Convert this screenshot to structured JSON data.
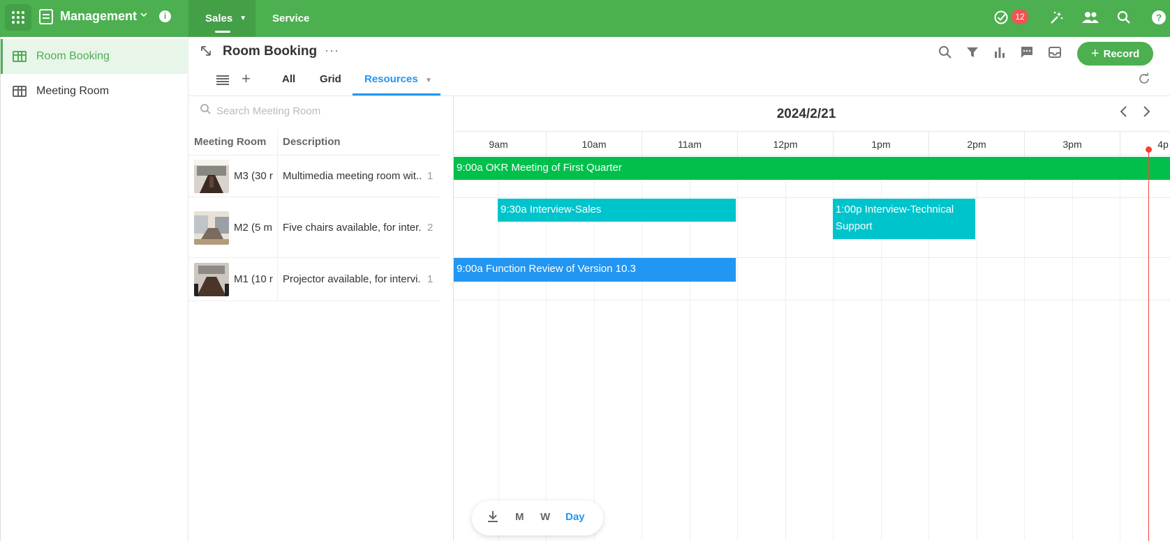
{
  "topbar": {
    "app_name": "Management",
    "nav_tabs": [
      {
        "label": "Sales",
        "active": true
      },
      {
        "label": "Service",
        "active": false
      }
    ],
    "notification_count": "12",
    "icons": [
      "apps-grid-icon",
      "document-icon",
      "chevron-down-icon",
      "info-icon",
      "check-circle-icon",
      "magic-wand-icon",
      "people-icon",
      "search-icon",
      "help-icon"
    ]
  },
  "sidebar": {
    "items": [
      {
        "label": "Room Booking",
        "active": true
      },
      {
        "label": "Meeting Room",
        "active": false
      }
    ]
  },
  "view": {
    "title": "Room Booking",
    "record_label": "Record",
    "tabs": [
      {
        "label": "All",
        "active": false
      },
      {
        "label": "Grid",
        "active": false
      },
      {
        "label": "Resources",
        "active": true
      }
    ]
  },
  "resources": {
    "search_placeholder": "Search Meeting Room",
    "columns": [
      "Meeting Room",
      "Description"
    ],
    "rows": [
      {
        "name": "M3 (30 r",
        "description": "Multimedia meeting room wit..",
        "count": "1"
      },
      {
        "name": "M2 (5 m",
        "description": "Five chairs available, for inter.",
        "count": "2"
      },
      {
        "name": "M1 (10 r",
        "description": "Projector available, for intervi.",
        "count": "1"
      }
    ]
  },
  "timeline": {
    "date": "2024/2/21",
    "hours": [
      "9am",
      "10am",
      "11am",
      "12pm",
      "1pm",
      "2pm",
      "3pm",
      "4p"
    ],
    "events": [
      {
        "label": "9:00a OKR Meeting of First Quarter",
        "color": "#00c04b",
        "row": 0
      },
      {
        "label": "9:30a Interview-Sales",
        "color": "#00c4cc",
        "row": 1
      },
      {
        "label": "1:00p Interview-Technical Support",
        "color": "#00c4cc",
        "row": 1
      },
      {
        "label": "9:00a Function Review of Version 10.3",
        "color": "#2196f3",
        "row": 2
      }
    ]
  },
  "switcher": {
    "items": [
      {
        "label": "M",
        "active": false
      },
      {
        "label": "W",
        "active": false
      },
      {
        "label": "Day",
        "active": true
      }
    ]
  },
  "colors": {
    "brand": "#4caf50",
    "accent": "#2196f3",
    "now_line": "#f44336",
    "badge": "#f05454"
  }
}
